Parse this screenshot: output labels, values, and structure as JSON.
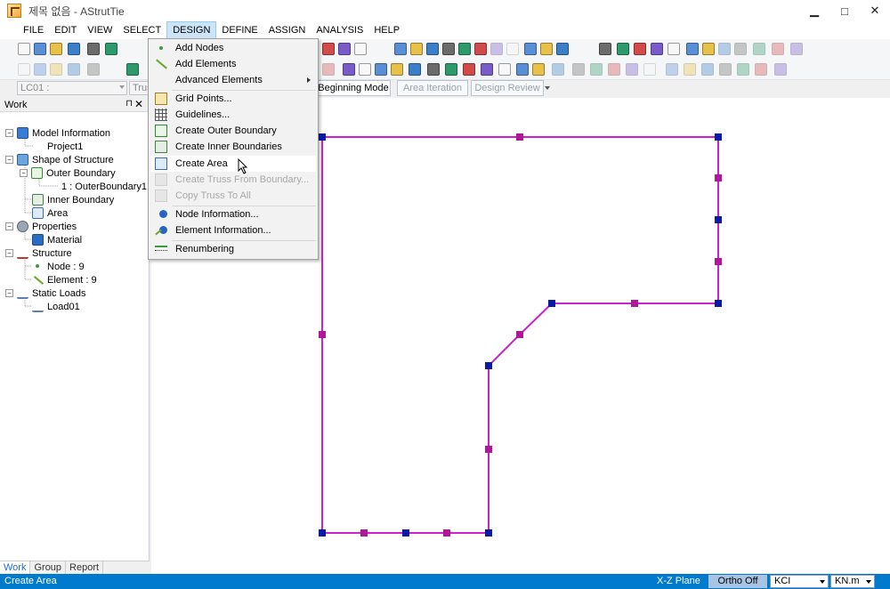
{
  "window": {
    "title": "제목 없음 - AStrutTie",
    "minimize": "▁",
    "maximize": "□",
    "close": "✕"
  },
  "menubar": {
    "items": [
      "FILE",
      "EDIT",
      "VIEW",
      "SELECT",
      "DESIGN",
      "DEFINE",
      "ASSIGN",
      "ANALYSIS",
      "HELP"
    ],
    "active": "DESIGN"
  },
  "selectors": {
    "load_case": "LC01 :",
    "truss": "Trus"
  },
  "mode_tabs": [
    "Beginning Mode",
    "Area Iteration",
    "Design Review"
  ],
  "work_panel": {
    "title": "Work",
    "pin": "⊓",
    "close": "✕",
    "tree": [
      {
        "label": "Model Information"
      },
      {
        "label": "Project1"
      },
      {
        "label": "Shape of Structure"
      },
      {
        "label": "Outer Boundary"
      },
      {
        "label": "1 : OuterBoundary1"
      },
      {
        "label": "Inner Boundary"
      },
      {
        "label": "Area"
      },
      {
        "label": "Properties"
      },
      {
        "label": "Material"
      },
      {
        "label": "Structure"
      },
      {
        "label": "Node : 9"
      },
      {
        "label": "Element : 9"
      },
      {
        "label": "Static Loads"
      },
      {
        "label": "Load01"
      }
    ],
    "tabs": [
      "Work",
      "Group",
      "Report"
    ]
  },
  "design_menu": {
    "items": [
      {
        "label": "Add Nodes",
        "icon": "add-nodes-icon",
        "enabled": true
      },
      {
        "label": "Add Elements",
        "icon": "add-elements-icon",
        "enabled": true
      },
      {
        "label": "Advanced Elements",
        "icon": "",
        "enabled": true,
        "submenu": true
      },
      {
        "label": "Grid Points...",
        "icon": "grid-points-icon",
        "enabled": true
      },
      {
        "label": "Guidelines...",
        "icon": "guidelines-icon",
        "enabled": true
      },
      {
        "label": "Create Outer Boundary",
        "icon": "outer-boundary-icon",
        "enabled": true
      },
      {
        "label": "Create Inner Boundaries",
        "icon": "inner-boundary-icon",
        "enabled": true
      },
      {
        "label": "Create Area",
        "icon": "area-icon",
        "enabled": true,
        "hover": true
      },
      {
        "label": "Create Truss From Boundary...",
        "icon": "truss-from-boundary-icon",
        "enabled": false
      },
      {
        "label": "Copy Truss To All",
        "icon": "copy-truss-icon",
        "enabled": false
      },
      {
        "label": "Node Information...",
        "icon": "node-info-icon",
        "enabled": true
      },
      {
        "label": "Element Information...",
        "icon": "element-info-icon",
        "enabled": true
      },
      {
        "label": "Renumbering",
        "icon": "renumbering-icon",
        "enabled": true
      }
    ]
  },
  "colors": {
    "boundary_line": "#cc22cc",
    "node_primary": "#0a1aa8",
    "node_midpoint": "#b0189a",
    "statusbar": "#007acc",
    "menu_active": "#cce4f7"
  },
  "statusbar": {
    "message": "Create Area",
    "plane": "X-Z Plane",
    "ortho": "Ortho Off",
    "code": "KCI",
    "units": "KN.m"
  }
}
